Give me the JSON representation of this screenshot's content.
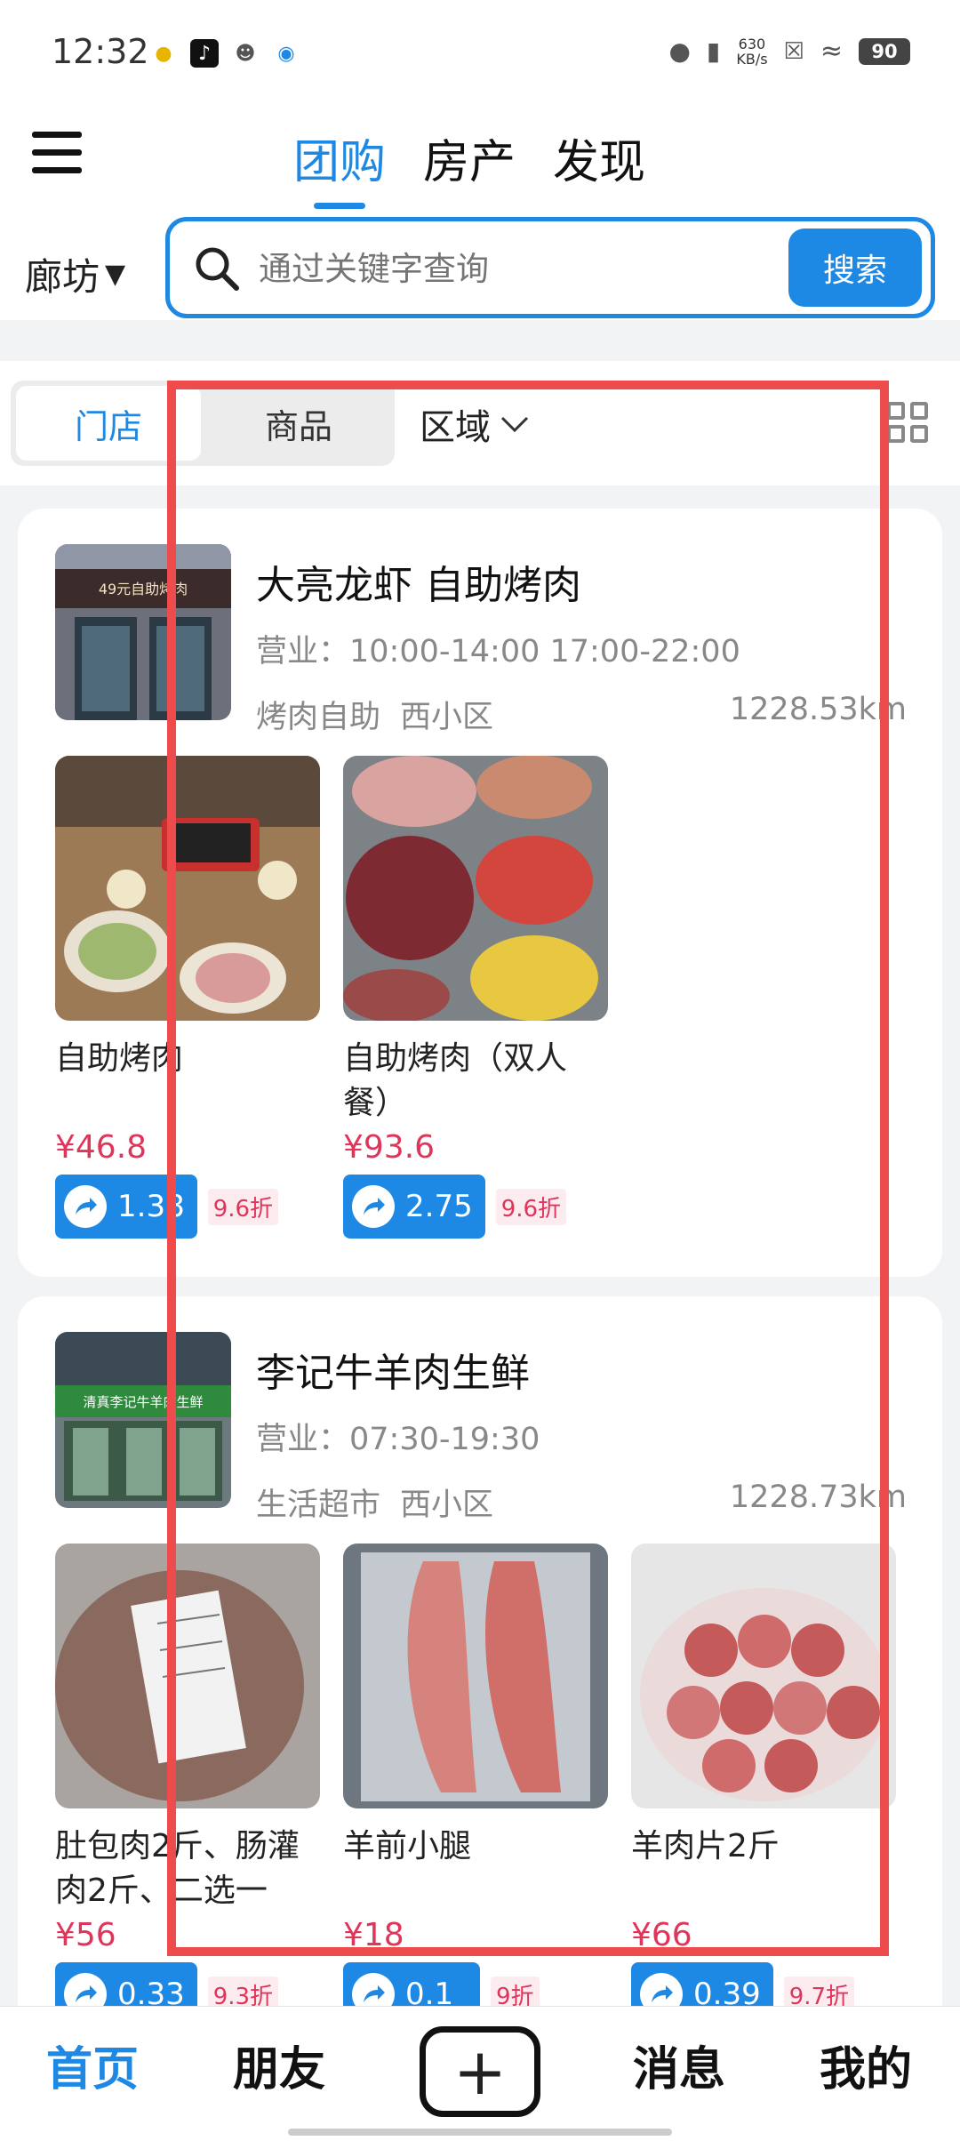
{
  "status_bar": {
    "time": "12:32",
    "net_speed_value": "630",
    "net_speed_unit": "KB/s",
    "battery": "90"
  },
  "header": {
    "tabs": [
      "团购",
      "房产",
      "发现"
    ],
    "active_tab": 0,
    "city": "廊坊"
  },
  "search": {
    "placeholder": "通过关键字查询",
    "button": "搜索"
  },
  "filters": {
    "store": "门店",
    "goods": "商品",
    "region": "区域"
  },
  "stores": [
    {
      "name": "大亮龙虾 自助烤肉",
      "hours": "营业：10:00-14:00 17:00-22:00",
      "category": "烤肉自助",
      "area": "西小区",
      "distance": "1228.53km",
      "photo_sign": "49元自助烤肉",
      "products": [
        {
          "name": "自助烤肉",
          "price": "¥46.8",
          "share": "1.38",
          "discount": "9.6折"
        },
        {
          "name": "自助烤肉（双人餐）",
          "price": "¥93.6",
          "share": "2.75",
          "discount": "9.6折"
        }
      ]
    },
    {
      "name": "李记牛羊肉生鲜",
      "hours": "营业：07:30-19:30",
      "category": "生活超市",
      "area": "西小区",
      "distance": "1228.73km",
      "photo_sign": "清真李记牛羊肉生鲜",
      "products": [
        {
          "name": "肚包肉2斤、肠灌肉2斤、二选一",
          "price": "¥56",
          "share": "0.33",
          "discount": "9.3折"
        },
        {
          "name": "羊前小腿",
          "price": "¥18",
          "share": "0.1",
          "discount": "9折"
        },
        {
          "name": "羊肉片2斤",
          "price": "¥66",
          "share": "0.39",
          "discount": "9.7折"
        }
      ]
    }
  ],
  "bottom_nav": {
    "home": "首页",
    "friends": "朋友",
    "add": "+",
    "messages": "消息",
    "mine": "我的"
  },
  "colors": {
    "accent": "#1e88e5",
    "price": "#e0355a",
    "highlight": "#ee4c4c"
  }
}
